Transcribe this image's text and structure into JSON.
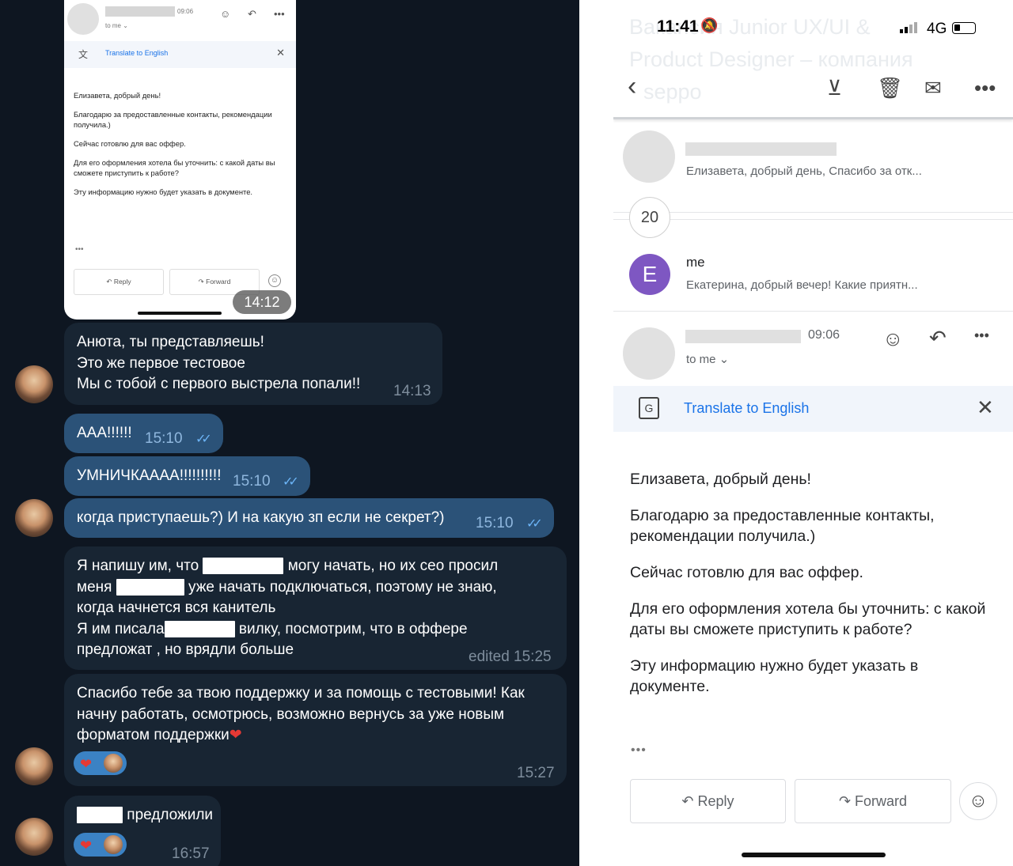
{
  "telegram": {
    "screenshot_email": {
      "time": "09:06",
      "to_me": "to me ⌄",
      "translate": "Translate to English",
      "body": [
        "Елизавета, добрый день!",
        "Благодарю за предоставленные контакты, рекомендации получила.)",
        "Сейчас готовлю для вас оффер.",
        "Для его оформления хотела бы уточнить: с какой даты вы сможете приступить к работе?",
        "Эту информацию нужно будет указать в документе."
      ],
      "dots": "•••",
      "reply": "Reply",
      "forward": "Forward",
      "stamp": "14:12"
    },
    "messages": [
      {
        "lines": [
          "Анюта, ты представляешь!",
          "Это же первое тестовое",
          "Мы с тобой с первого выстрела попали!!"
        ],
        "time": "14:13"
      },
      {
        "text": "ААА!!!!!!",
        "time": "15:10"
      },
      {
        "text": "УМНИЧКАААА!!!!!!!!!!",
        "time": "15:10"
      },
      {
        "text": "когда приступаешь?) И на какую зп если не секрет?)",
        "time": "15:10"
      },
      {
        "l1a": "Я напишу им, что",
        "l1b": "могу начать, но их сео просил",
        "l2a": "меня",
        "l2b": "уже начать подключаться, поэтому не знаю,",
        "l3": "когда начнется вся канитель",
        "l4a": "Я им писала",
        "l4b": "вилку, посмотрим, что в оффере",
        "l5": "предложат , но врядли больше",
        "time": "edited 15:25"
      },
      {
        "lines": [
          "Спасибо тебе за твою поддержку и за помощь с тестовыми! Как",
          "начну работать, осмотрюсь, возможно вернусь за уже новым",
          "форматом поддержки"
        ],
        "time": "15:27"
      },
      {
        "text": "предложили",
        "time": "16:57"
      }
    ]
  },
  "gmail": {
    "status": {
      "time": "11:41",
      "network": "4G"
    },
    "ghost_title": [
      "Bакансия Junior UX/UI &",
      "Product Designer – компания",
      "seppo"
    ],
    "thread": [
      {
        "snippet": "Елизавета, добрый день, Спасибо за отк..."
      },
      {
        "count": "20"
      },
      {
        "initial": "E",
        "sender": "me",
        "snippet": "Екатерина, добрый вечер! Какие приятн..."
      }
    ],
    "header": {
      "time": "09:06",
      "to_me": "to me ⌄"
    },
    "translate": "Translate to English",
    "body": [
      "Елизавета, добрый день!",
      "Благодарю за предоставленные контакты, рекомендации получила.)",
      "Сейчас готовлю для вас оффер.",
      "Для его оформления хотела бы уточнить: с какой даты вы сможете приступить к работе?",
      "Эту информацию нужно будет указать в документе."
    ],
    "dots": "•••",
    "reply": "Reply",
    "forward": "Forward",
    "icons": [
      "back-icon",
      "archive-icon",
      "delete-icon",
      "mark-unread-icon",
      "more-icon",
      "emoji-icon",
      "reply-icon",
      "translate-icon",
      "close-icon",
      "forward-icon"
    ]
  }
}
